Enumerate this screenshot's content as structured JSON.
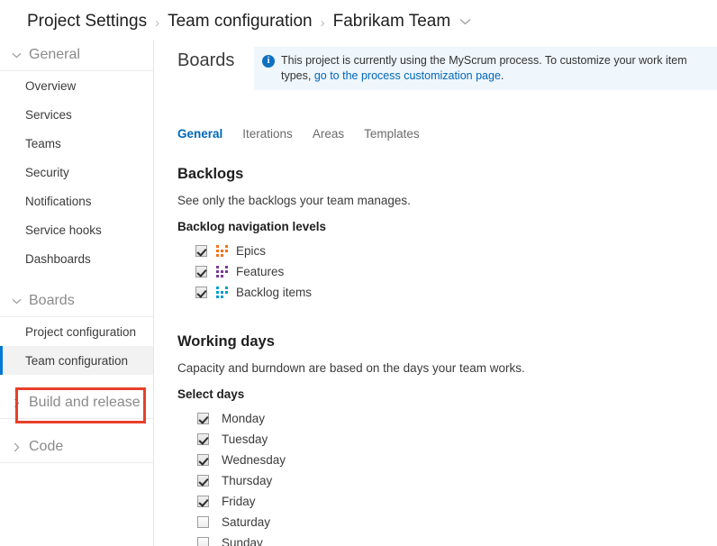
{
  "breadcrumb": {
    "items": [
      {
        "label": "Project Settings"
      },
      {
        "label": "Team configuration"
      },
      {
        "label": "Fabrikam Team"
      }
    ],
    "separator": "›",
    "chevron_icon": "chevron-down-icon"
  },
  "sidebar": {
    "groups": [
      {
        "label": "General",
        "expanded": true,
        "icon": "chevron-down-icon",
        "items": [
          {
            "label": "Overview",
            "selected": false
          },
          {
            "label": "Services",
            "selected": false
          },
          {
            "label": "Teams",
            "selected": false
          },
          {
            "label": "Security",
            "selected": false
          },
          {
            "label": "Notifications",
            "selected": false
          },
          {
            "label": "Service hooks",
            "selected": false
          },
          {
            "label": "Dashboards",
            "selected": false
          }
        ]
      },
      {
        "label": "Boards",
        "expanded": true,
        "icon": "chevron-down-icon",
        "items": [
          {
            "label": "Project configuration",
            "selected": false
          },
          {
            "label": "Team configuration",
            "selected": true
          }
        ]
      },
      {
        "label": "Build and release",
        "expanded": false,
        "icon": "chevron-right-icon",
        "items": []
      },
      {
        "label": "Code",
        "expanded": false,
        "icon": "chevron-right-icon",
        "items": []
      }
    ],
    "selection_accent_color": "#0078d4",
    "annotation_color": "#e8402a"
  },
  "main": {
    "page_title": "Boards",
    "banner": {
      "icon": "info-icon",
      "text_before_link": "This project is currently using the MyScrum process. To customize your work item types, ",
      "link_text": "go to the process customization page",
      "text_after_link": ".",
      "background_color": "#eff6fc",
      "link_color": "#0067b8"
    },
    "tabs": [
      {
        "label": "General",
        "active": true
      },
      {
        "label": "Iterations",
        "active": false
      },
      {
        "label": "Areas",
        "active": false
      },
      {
        "label": "Templates",
        "active": false
      }
    ],
    "backlogs": {
      "title": "Backlogs",
      "description": "See only the backlogs your team manages.",
      "sub_label": "Backlog navigation levels",
      "levels": [
        {
          "label": "Epics",
          "checked": true,
          "icon": "backlog-level-icon",
          "color": "#f2711c"
        },
        {
          "label": "Features",
          "checked": true,
          "icon": "backlog-level-icon",
          "color": "#773b93"
        },
        {
          "label": "Backlog items",
          "checked": true,
          "icon": "backlog-level-icon",
          "color": "#009ccc"
        }
      ]
    },
    "working_days": {
      "title": "Working days",
      "description": "Capacity and burndown are based on the days your team works.",
      "sub_label": "Select days",
      "days": [
        {
          "label": "Monday",
          "checked": true
        },
        {
          "label": "Tuesday",
          "checked": true
        },
        {
          "label": "Wednesday",
          "checked": true
        },
        {
          "label": "Thursday",
          "checked": true
        },
        {
          "label": "Friday",
          "checked": true
        },
        {
          "label": "Saturday",
          "checked": false
        },
        {
          "label": "Sunday",
          "checked": false
        }
      ]
    }
  }
}
